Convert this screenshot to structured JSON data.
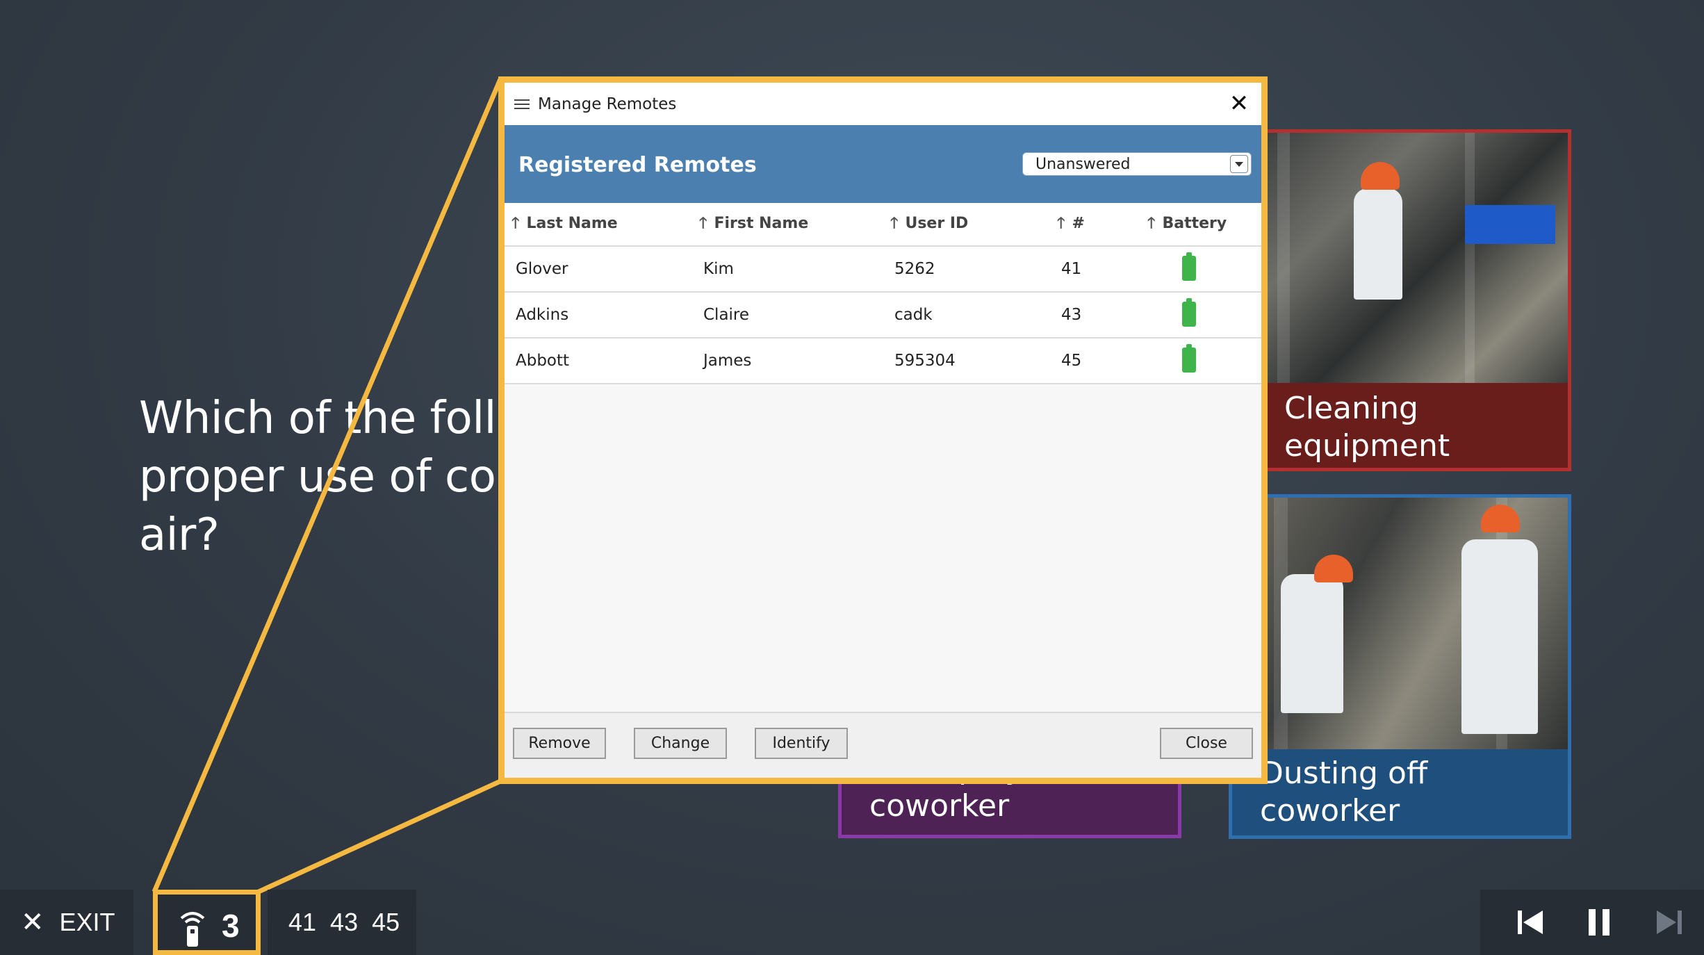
{
  "question": {
    "lines": [
      "Which of the follo",
      "proper use of co",
      "air?"
    ]
  },
  "answers": [
    {
      "id": "a",
      "label": "Cleaning equipment",
      "color": "#b3302e"
    },
    {
      "id": "b",
      "label_lines": [
        "Dusting off",
        "coworker"
      ],
      "color": "#2f6fb0"
    },
    {
      "id": "c",
      "label_lines": [
        "Horseplay with",
        "coworker"
      ],
      "color": "#8a3aa8"
    }
  ],
  "dialog": {
    "icon": "settings-sliders-icon",
    "title": "Manage Remotes",
    "close_glyph": "✕",
    "header_title": "Registered Remotes",
    "filter": {
      "selected": "Unanswered"
    },
    "columns": [
      "Last Name",
      "First Name",
      "User ID",
      "#",
      "Battery"
    ],
    "sort_arrow": "🡑",
    "rows": [
      {
        "last": "Glover",
        "first": "Kim",
        "user_id": "5262",
        "num": "41",
        "battery": "full"
      },
      {
        "last": "Adkins",
        "first": "Claire",
        "user_id": "cadk",
        "num": "43",
        "battery": "full"
      },
      {
        "last": "Abbott",
        "first": "James",
        "user_id": "595304",
        "num": "45",
        "battery": "full"
      }
    ],
    "buttons": {
      "remove": "Remove",
      "change": "Change",
      "identify": "Identify",
      "close": "Close"
    }
  },
  "bottom_bar": {
    "exit_glyph": "✕",
    "exit_label": "EXIT",
    "remote_count": "3",
    "remote_ids": "41 43 45"
  },
  "colors": {
    "highlight": "#f5b942",
    "dialog_header": "#4a7fb0",
    "battery_ok": "#3fb44a"
  }
}
